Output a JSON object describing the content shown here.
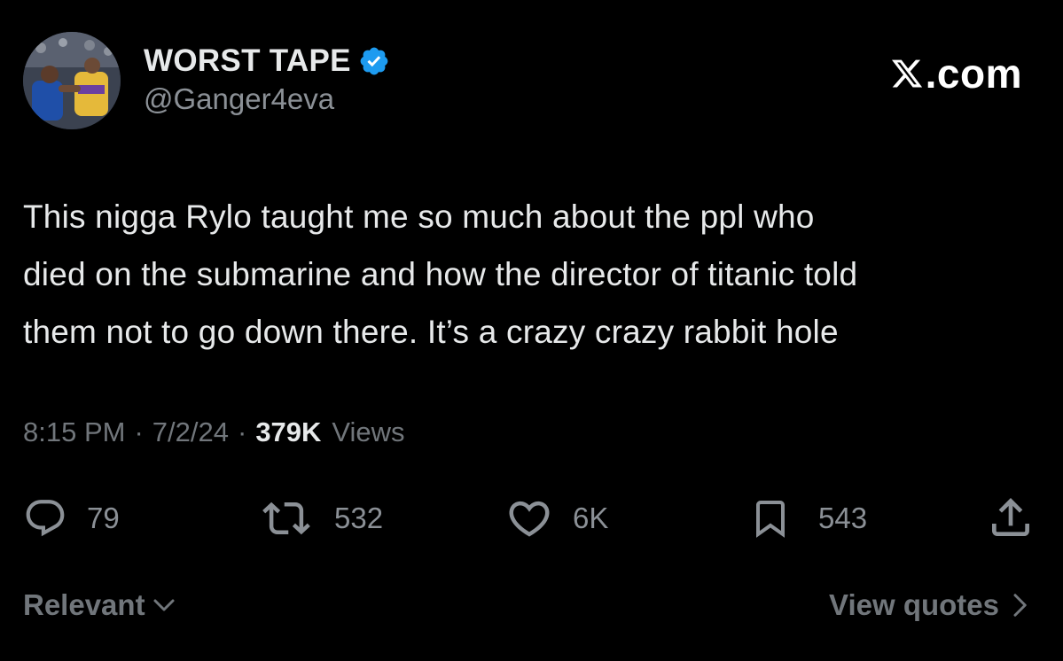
{
  "author": {
    "display_name": "WORST TAPE",
    "handle": "@Ganger4eva",
    "verified": true,
    "verified_color": "#1d9bf0"
  },
  "brand": {
    "label": ".com",
    "icon": "x-logo-icon"
  },
  "tweet": {
    "lines": [
      "This nigga Rylo taught me so much about the ppl who",
      "died on the submarine and how the director of titanic told",
      "them not to go down there. It’s a crazy crazy rabbit hole"
    ]
  },
  "meta": {
    "time": "8:15 PM",
    "separator": "·",
    "date": "7/2/24",
    "views_count": "379K",
    "views_label": "Views"
  },
  "actions": {
    "replies": {
      "icon": "reply-bubble-icon",
      "count": "79"
    },
    "reposts": {
      "icon": "repost-icon",
      "count": "532"
    },
    "likes": {
      "icon": "heart-icon",
      "count": "6K"
    },
    "bookmarks": {
      "icon": "bookmark-icon",
      "count": "543"
    },
    "share": {
      "icon": "share-icon"
    }
  },
  "footer": {
    "sort_label": "Relevant",
    "quotes_label": "View quotes"
  },
  "colors": {
    "background": "#000000",
    "primary_text": "#e7e9ea",
    "secondary_text": "#71767b",
    "accent_blue": "#1d9bf0"
  }
}
